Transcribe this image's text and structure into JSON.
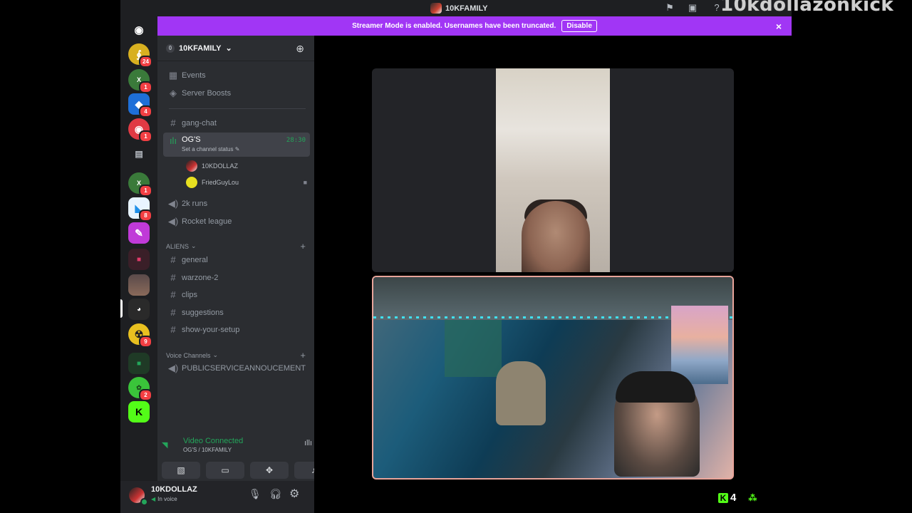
{
  "window": {
    "title": "10KFAMILY",
    "watermark": "10kdollazonkick"
  },
  "banner": {
    "text": "Streamer Mode is enabled. Usernames have been truncated.",
    "disable_label": "Disable",
    "close_icon": "×"
  },
  "rail": {
    "badges": [
      "24",
      "1",
      "4",
      "1",
      "1",
      "8",
      "9",
      "2"
    ]
  },
  "server": {
    "name": "10KFAMILY",
    "boost_level": "0"
  },
  "sidebar": {
    "events_label": "Events",
    "boosts_label": "Server Boosts",
    "channels_top": [
      {
        "name": "gang-chat"
      }
    ],
    "active_voice": {
      "name": "OG'S",
      "status": "Set a channel status",
      "timer": "28:30",
      "users": [
        "10KDOLLAZ",
        "FriedGuyLou"
      ]
    },
    "voice_more": [
      "2k runs",
      "Rocket league"
    ],
    "category_aliens": "ALIENS",
    "aliens_channels": [
      "general",
      "warzone-2",
      "clips",
      "suggestions",
      "show-your-setup"
    ],
    "category_voice": "Voice Channels",
    "voice_channels": [
      "PUBLICSERVICEANNOUCEMENT"
    ]
  },
  "voice_panel": {
    "status": "Video Connected",
    "location": "OG'S / 10KFAMILY"
  },
  "user_panel": {
    "username": "10KDOLLAZ",
    "status": "In voice"
  },
  "kick_overlay": {
    "viewers": "4"
  },
  "colors": {
    "banner": "#a136f5",
    "voice_green": "#23a55a",
    "badge_red": "#f23f43",
    "tile_border": "#e8a49a",
    "kick_green": "#53fc18"
  }
}
